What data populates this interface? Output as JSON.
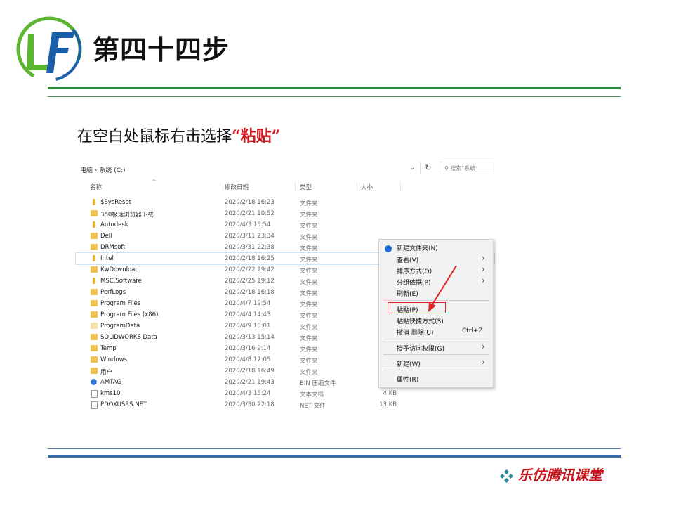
{
  "header": {
    "title": "第四十四步",
    "logo_text": "LF"
  },
  "instruction": {
    "prefix": "在空白处鼠标右击选择",
    "highlight": "“粘贴”"
  },
  "explorer": {
    "breadcrumb": "电脑 › 系统 (C:)",
    "search_placeholder": "搜索\"系统",
    "columns": [
      "名称",
      "修改日期",
      "类型",
      "大小"
    ],
    "rows": [
      {
        "name": "$SysReset",
        "date": "2020/2/18 16:23",
        "type": "文件夹",
        "size": "",
        "icon": "folder-icon"
      },
      {
        "name": "360极速浏览器下载",
        "date": "2020/2/21 10:52",
        "type": "文件夹",
        "size": "",
        "icon": "folder-icon"
      },
      {
        "name": "Autodesk",
        "date": "2020/4/3 15:54",
        "type": "文件夹",
        "size": "",
        "icon": "folder-icon"
      },
      {
        "name": "Dell",
        "date": "2020/3/11 23:34",
        "type": "文件夹",
        "size": "",
        "icon": "folder-icon"
      },
      {
        "name": "DRMsoft",
        "date": "2020/3/31 22:38",
        "type": "文件夹",
        "size": "",
        "icon": "folder-icon"
      },
      {
        "name": "Intel",
        "date": "2020/2/18 16:25",
        "type": "文件夹",
        "size": "",
        "icon": "folder-icon"
      },
      {
        "name": "KwDownload",
        "date": "2020/2/22 19:42",
        "type": "文件夹",
        "size": "",
        "icon": "folder-icon"
      },
      {
        "name": "MSC.Software",
        "date": "2020/2/25 19:12",
        "type": "文件夹",
        "size": "",
        "icon": "folder-icon"
      },
      {
        "name": "PerfLogs",
        "date": "2020/2/18 16:18",
        "type": "文件夹",
        "size": "",
        "icon": "folder-icon"
      },
      {
        "name": "Program Files",
        "date": "2020/4/7 19:54",
        "type": "文件夹",
        "size": "",
        "icon": "folder-icon"
      },
      {
        "name": "Program Files (x86)",
        "date": "2020/4/4 14:43",
        "type": "文件夹",
        "size": "",
        "icon": "folder-icon"
      },
      {
        "name": "ProgramData",
        "date": "2020/4/9 10:01",
        "type": "文件夹",
        "size": "",
        "icon": "folder-icon"
      },
      {
        "name": "SOLIDWORKS Data",
        "date": "2020/3/13 15:14",
        "type": "文件夹",
        "size": "",
        "icon": "folder-icon"
      },
      {
        "name": "Temp",
        "date": "2020/3/16 9:14",
        "type": "文件夹",
        "size": "",
        "icon": "folder-icon"
      },
      {
        "name": "Windows",
        "date": "2020/4/8 17:05",
        "type": "文件夹",
        "size": "",
        "icon": "folder-icon"
      },
      {
        "name": "用户",
        "date": "2020/2/18 16:49",
        "type": "文件夹",
        "size": "",
        "icon": "folder-icon"
      },
      {
        "name": "AMTAG",
        "date": "2020/2/21 19:43",
        "type": "BIN 压缩文件",
        "size": "",
        "icon": "bin-file-icon"
      },
      {
        "name": "kms10",
        "date": "2020/4/3 15:24",
        "type": "文本文档",
        "size": "4 KB",
        "icon": "text-file-icon"
      },
      {
        "name": "PDOXUSRS.NET",
        "date": "2020/3/30 22:18",
        "type": "NET 文件",
        "size": "13 KB",
        "icon": "file-icon"
      }
    ]
  },
  "context_menu": {
    "new_folder": "新建文件夹(N)",
    "view": "查看(V)",
    "sort_by": "排序方式(O)",
    "group_by": "分组依据(P)",
    "refresh": "刷新(E)",
    "paste": "粘贴(P)",
    "paste_shortcut": "粘贴快捷方式(S)",
    "undo_delete": "撤消 删除(U)",
    "undo_shortcut": "Ctrl+Z",
    "give_access": "授予访问权限(G)",
    "new": "新建(W)",
    "properties": "属性(R)"
  },
  "footer": {
    "brand": "乐仿腾讯课堂"
  },
  "colors": {
    "green_rule": "#2e8b3e",
    "blue_rule": "#3c6fa8",
    "highlight_red": "#d0161b",
    "logo_green": "#5cb531",
    "logo_blue": "#1b5fa8"
  }
}
